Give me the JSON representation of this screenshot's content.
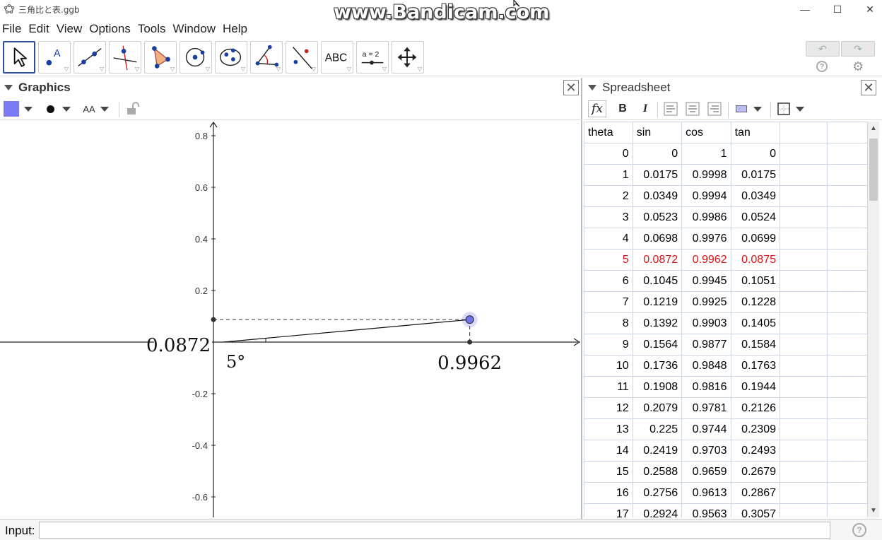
{
  "window": {
    "title": "三角比と表.ggb",
    "watermark": "www.Bandicam.com",
    "minimize": "—",
    "maximize": "☐",
    "close": "✕"
  },
  "menu": [
    "File",
    "Edit",
    "View",
    "Options",
    "Tools",
    "Window",
    "Help"
  ],
  "toolbar": {
    "tools": [
      {
        "name": "move-tool"
      },
      {
        "name": "point-tool",
        "label": "A"
      },
      {
        "name": "line-tool"
      },
      {
        "name": "perpendicular-line-tool"
      },
      {
        "name": "polygon-tool"
      },
      {
        "name": "circle-center-point-tool"
      },
      {
        "name": "ellipse-tool"
      },
      {
        "name": "angle-tool"
      },
      {
        "name": "reflect-tool"
      },
      {
        "name": "text-tool",
        "label": "ABC"
      },
      {
        "name": "slider-tool",
        "label": "a = 2"
      },
      {
        "name": "move-graphics-view-tool"
      }
    ],
    "undo": "↶",
    "redo": "↷",
    "help": "?",
    "settings": "⚙"
  },
  "graphics": {
    "title": "Graphics",
    "style": {
      "color": "#7b7bf5",
      "text_size_label": "AA"
    },
    "y_ticks": [
      "0.8",
      "0.6",
      "0.4",
      "0.2",
      "-0.2",
      "-0.4",
      "-0.6"
    ],
    "y_tick_values": [
      0.8,
      0.6,
      0.4,
      0.2,
      -0.2,
      -0.4,
      -0.6
    ],
    "angle_label": "5°",
    "sin_label": "0.0872",
    "cos_label": "0.9962",
    "point": {
      "x": 0.9962,
      "y": 0.0872
    },
    "axis_color": "#222222",
    "point_color": "#6f75e6"
  },
  "spreadsheet": {
    "title": "Spreadsheet",
    "fx": "fx",
    "bold": "B",
    "italic": "I",
    "headers": [
      "theta",
      "sin",
      "cos",
      "tan"
    ],
    "selected_index": 5,
    "selected_color": "#dd1111",
    "rows": [
      [
        "0",
        "0",
        "1",
        "0"
      ],
      [
        "1",
        "0.0175",
        "0.9998",
        "0.0175"
      ],
      [
        "2",
        "0.0349",
        "0.9994",
        "0.0349"
      ],
      [
        "3",
        "0.0523",
        "0.9986",
        "0.0524"
      ],
      [
        "4",
        "0.0698",
        "0.9976",
        "0.0699"
      ],
      [
        "5",
        "0.0872",
        "0.9962",
        "0.0875"
      ],
      [
        "6",
        "0.1045",
        "0.9945",
        "0.1051"
      ],
      [
        "7",
        "0.1219",
        "0.9925",
        "0.1228"
      ],
      [
        "8",
        "0.1392",
        "0.9903",
        "0.1405"
      ],
      [
        "9",
        "0.1564",
        "0.9877",
        "0.1584"
      ],
      [
        "10",
        "0.1736",
        "0.9848",
        "0.1763"
      ],
      [
        "11",
        "0.1908",
        "0.9816",
        "0.1944"
      ],
      [
        "12",
        "0.2079",
        "0.9781",
        "0.2126"
      ],
      [
        "13",
        "0.225",
        "0.9744",
        "0.2309"
      ],
      [
        "14",
        "0.2419",
        "0.9703",
        "0.2493"
      ],
      [
        "15",
        "0.2588",
        "0.9659",
        "0.2679"
      ],
      [
        "16",
        "0.2756",
        "0.9613",
        "0.2867"
      ],
      [
        "17",
        "0.2924",
        "0.9563",
        "0.3057"
      ]
    ]
  },
  "input": {
    "label": "Input:",
    "value": "",
    "help": "?"
  }
}
